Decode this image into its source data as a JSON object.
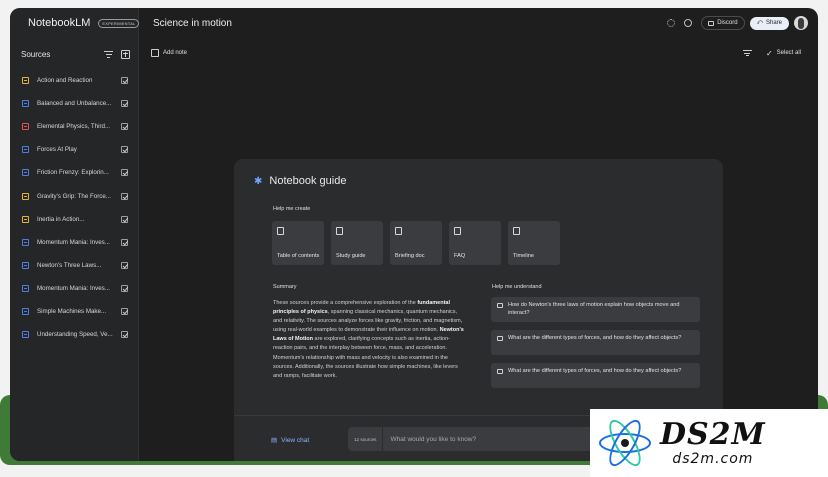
{
  "app": {
    "brand": "NotebookLM",
    "badge": "EXPERIMENTAL",
    "notebook_title": "Science in motion"
  },
  "header": {
    "discord_label": "Discord",
    "share_label": "Share"
  },
  "sidebar": {
    "title": "Sources",
    "items": [
      {
        "label": "Action and Reaction",
        "color": "#e5b53b"
      },
      {
        "label": "Balanced and Unbalance...",
        "color": "#4f7de0"
      },
      {
        "label": "Elemental Physics, Third...",
        "color": "#e5534b"
      },
      {
        "label": "Forces At Play",
        "color": "#4f7de0"
      },
      {
        "label": "Friction Frenzy: Explorin...",
        "color": "#4f7de0"
      },
      {
        "label": "Gravity's Grip: The Force...",
        "color": "#e5b53b"
      },
      {
        "label": "Inertia in Action...",
        "color": "#e5b53b"
      },
      {
        "label": "Momentum Mania: Inves...",
        "color": "#4f7de0"
      },
      {
        "label": "Newton's Three Laws...",
        "color": "#4f7de0"
      },
      {
        "label": "Momentum Mania: Inves...",
        "color": "#4f7de0"
      },
      {
        "label": "Simple Machines Make...",
        "color": "#4f7de0"
      },
      {
        "label": "Understanding Speed, Ve...",
        "color": "#4f7de0"
      }
    ]
  },
  "toolbar": {
    "add_note_label": "Add note",
    "select_all_label": "Select all"
  },
  "guide": {
    "title": "Notebook guide",
    "help_create_label": "Help me create",
    "cards": [
      {
        "label": "Table of contents"
      },
      {
        "label": "Study guide"
      },
      {
        "label": "Briefing doc"
      },
      {
        "label": "FAQ"
      },
      {
        "label": "Timeline"
      }
    ],
    "summary_title": "Summary",
    "summary_parts": [
      "These sources provide a comprehensive exploration of the ",
      "fundamental principles of physics",
      ", spanning classical mechanics, quantum mechanics, and relativity. The sources analyze forces like gravity, friction, and magnetism, using real-world examples to demonstrate their influence on motion. ",
      "Newton's Laws of Motion",
      " are explored, clarifying concepts such as inertia, action-reaction pairs, and the interplay between force, mass, and acceleration. Momentum's relationship with mass and velocity is also examined in the sources. Additionally, the sources illustrate how simple machines, like levers and ramps, facilitate work."
    ],
    "understand_title": "Help me understand",
    "questions": [
      "How do Newton's three laws of motion explain how objects move and interact?",
      "What are the different types of forces, and how do they affect objects?",
      "What are the different types of forces, and how do they affect objects?"
    ],
    "view_chat_label": "View chat",
    "source_count": "12 sources",
    "chat_placeholder": "What would you like to know?"
  },
  "watermark": {
    "big": "DS2M",
    "small": "ds2m.com"
  }
}
